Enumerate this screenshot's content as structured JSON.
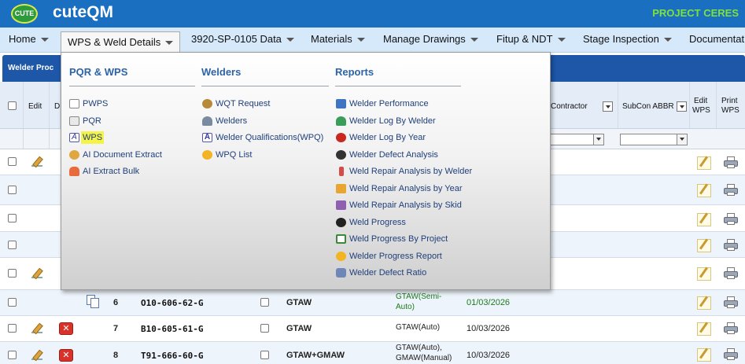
{
  "app": {
    "logo_text": "CUTE",
    "title": "cuteQM",
    "project": "PROJECT CERES"
  },
  "nav": [
    {
      "label": "Home"
    },
    {
      "label": "WPS & Weld Details"
    },
    {
      "label": "3920-SP-0105 Data"
    },
    {
      "label": "Materials"
    },
    {
      "label": "Manage Drawings"
    },
    {
      "label": "Fitup & NDT"
    },
    {
      "label": "Stage Inspection"
    },
    {
      "label": "Documentati"
    }
  ],
  "panel": {
    "title": "Welder Proc"
  },
  "grid": {
    "headers": {
      "edit": "Edit",
      "d": "D",
      "contractor": "Contractor",
      "subcon_abbr": "SubCon ABBR",
      "edit_wps_1": "Edit",
      "edit_wps_2": "WPS",
      "print_wps_1": "Print",
      "print_wps_2": "WPS"
    },
    "rows": [
      {
        "no": "",
        "wps": "",
        "process": "",
        "process_type": "",
        "date": ""
      },
      {
        "no": "",
        "wps": "",
        "process": "",
        "process_type": "",
        "date": ""
      },
      {
        "no": "",
        "wps": "",
        "process": "",
        "process_type": "",
        "date": ""
      },
      {
        "no": "",
        "wps": "",
        "process": "",
        "process_type": "",
        "date": ""
      },
      {
        "no": "",
        "wps": "",
        "process": "",
        "process_type": "",
        "date": ""
      },
      {
        "no": "6",
        "wps": "O10-606-62-G",
        "process": "GTAW",
        "process_type_1": "GTAW(Semi-",
        "process_type_2": "Auto)",
        "date": "01/03/2026"
      },
      {
        "no": "7",
        "wps": "B10-605-61-G",
        "process": "GTAW",
        "process_type_1": "GTAW(Auto)",
        "process_type_2": "",
        "date": "10/03/2026"
      },
      {
        "no": "8",
        "wps": "T91-666-60-G",
        "process": "GTAW+GMAW",
        "process_type_1": "GTAW(Auto),",
        "process_type_2": "GMAW(Manual)",
        "date": "10/03/2026"
      }
    ],
    "delete_glyph": "✕"
  },
  "menu": {
    "col1": {
      "heading": "PQR & WPS",
      "items": [
        {
          "label": "PWPS",
          "icon": "document-icon"
        },
        {
          "label": "PQR",
          "icon": "document-icon"
        },
        {
          "label": "WPS",
          "icon": "font-icon"
        },
        {
          "label": "AI Document Extract",
          "icon": "ai-extract-icon"
        },
        {
          "label": "AI Extract Bulk",
          "icon": "ai-bulk-icon"
        }
      ]
    },
    "col2": {
      "heading": "Welders",
      "items": [
        {
          "label": "WQT Request",
          "icon": "welder-mask-icon"
        },
        {
          "label": "Welders",
          "icon": "users-icon"
        },
        {
          "label": "Welder Qualifications(WPQ)",
          "icon": "font-icon"
        },
        {
          "label": "WPQ List",
          "icon": "sun-icon"
        }
      ]
    },
    "col3": {
      "heading": "Reports",
      "items": [
        {
          "label": "Welder Performance",
          "icon": "chart-icon"
        },
        {
          "label": "Welder Log By Welder",
          "icon": "user-log-icon"
        },
        {
          "label": "Welder Log By Year",
          "icon": "ball-icon"
        },
        {
          "label": "Welder Defect Analysis",
          "icon": "defect-icon"
        },
        {
          "label": "Weld Repair Analysis by Welder",
          "icon": "repair-icon"
        },
        {
          "label": "Weld Repair Analysis by Year",
          "icon": "folder-icon"
        },
        {
          "label": "Weld Repair Analysis by Skid",
          "icon": "tools-icon"
        },
        {
          "label": "Weld Progress",
          "icon": "gear-icon"
        },
        {
          "label": "Weld Progress By Project",
          "icon": "sheet-icon"
        },
        {
          "label": "Welder Progress Report",
          "icon": "sun-icon"
        },
        {
          "label": "Welder Defect Ratio",
          "icon": "network-icon"
        }
      ]
    }
  },
  "colors": {
    "topbar": "#1b6fc0",
    "nav": "#d6e9fb",
    "panel": "#1e56a8",
    "project": "#7ee23a",
    "link": "#1f3f7a"
  }
}
